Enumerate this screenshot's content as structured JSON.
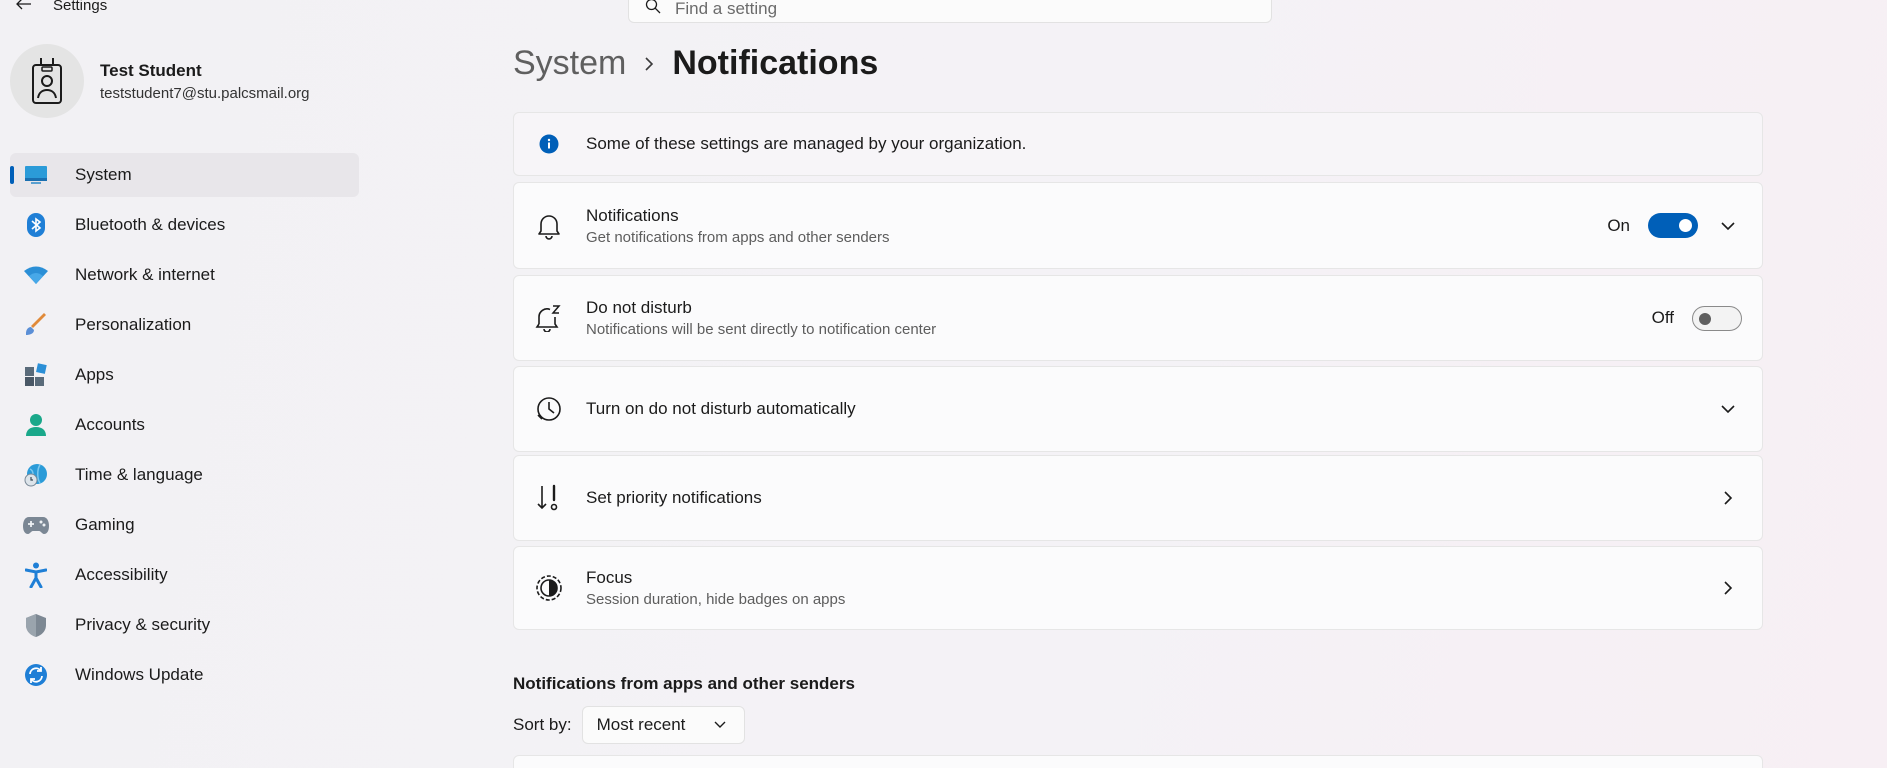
{
  "window": {
    "title": "Settings"
  },
  "search": {
    "placeholder": "Find a setting"
  },
  "profile": {
    "name": "Test Student",
    "email": "teststudent7@stu.palcsmail.org"
  },
  "nav": {
    "items": [
      {
        "label": "System",
        "icon": "system-icon",
        "active": true
      },
      {
        "label": "Bluetooth & devices",
        "icon": "bluetooth-icon"
      },
      {
        "label": "Network & internet",
        "icon": "wifi-icon"
      },
      {
        "label": "Personalization",
        "icon": "brush-icon"
      },
      {
        "label": "Apps",
        "icon": "apps-icon"
      },
      {
        "label": "Accounts",
        "icon": "accounts-icon"
      },
      {
        "label": "Time & language",
        "icon": "globe-clock-icon"
      },
      {
        "label": "Gaming",
        "icon": "gamepad-icon"
      },
      {
        "label": "Accessibility",
        "icon": "accessibility-icon"
      },
      {
        "label": "Privacy & security",
        "icon": "shield-icon"
      },
      {
        "label": "Windows Update",
        "icon": "update-icon"
      }
    ]
  },
  "breadcrumb": {
    "parent": "System",
    "current": "Notifications"
  },
  "info": {
    "text": "Some of these settings are managed by your organization."
  },
  "cards": {
    "notifications": {
      "title": "Notifications",
      "subtitle": "Get notifications from apps and other senders",
      "state": "On"
    },
    "dnd": {
      "title": "Do not disturb",
      "subtitle": "Notifications will be sent directly to notification center",
      "state": "Off"
    },
    "auto_dnd": {
      "title": "Turn on do not disturb automatically"
    },
    "priority": {
      "title": "Set priority notifications"
    },
    "focus": {
      "title": "Focus",
      "subtitle": "Session duration, hide badges on apps"
    }
  },
  "senders": {
    "heading": "Notifications from apps and other senders",
    "sort_label": "Sort by:",
    "sort_value": "Most recent"
  },
  "colors": {
    "accent": "#005fb8"
  }
}
